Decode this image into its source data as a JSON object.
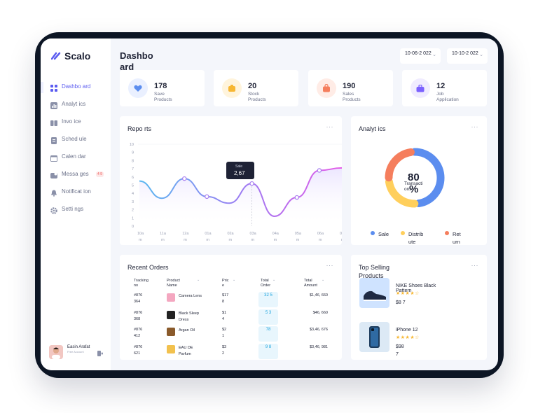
{
  "app": {
    "logo": "Scalo"
  },
  "sidebar": {
    "items": [
      {
        "label": "Dashbo ard",
        "icon": "grid-icon"
      },
      {
        "label": "Analyt ics",
        "icon": "chart-icon"
      },
      {
        "label": "Invo ice",
        "icon": "invoice-icon"
      },
      {
        "label": "Sched ule",
        "icon": "schedule-icon"
      },
      {
        "label": "Calen dar",
        "icon": "calendar-icon"
      },
      {
        "label": "Messa ges",
        "icon": "message-icon",
        "badge": "4 9"
      },
      {
        "label": "Notificat ion",
        "icon": "bell-icon"
      },
      {
        "label": "Setti ngs",
        "icon": "gear-icon"
      }
    ],
    "user": {
      "name": "Easin Arafat",
      "role": "Free Account"
    }
  },
  "header": {
    "title": "Dashbo ard",
    "date_from": "10-06-2 022",
    "date_to": "10-10-2 022"
  },
  "stats": [
    {
      "value": "178",
      "label": "Save Products",
      "icon": "heart-icon",
      "color": "#eaf0ff"
    },
    {
      "value": "20",
      "label": "Stock Products",
      "icon": "box-icon",
      "color": "#fff4dc"
    },
    {
      "value": "190",
      "label": "Sales Products",
      "icon": "bag-icon",
      "color": "#ffece6"
    },
    {
      "value": "12",
      "label": "Job Application",
      "icon": "briefcase-icon",
      "color": "#f0ecff"
    }
  ],
  "reports": {
    "title": "Repo rts",
    "more": "···",
    "tooltip": {
      "label": "Sale",
      "value": "2,67"
    },
    "chart_data": {
      "type": "area",
      "title": "Repo rts",
      "x": [
        "10a m",
        "11a m",
        "12a m",
        "01a m",
        "02a m",
        "03a m",
        "04a m",
        "05a m",
        "06a m",
        "07a m"
      ],
      "y_ticks": [
        "10",
        "9",
        "8",
        "7",
        "6",
        "5",
        "4",
        "3",
        "2",
        "1",
        "0"
      ],
      "ylim": [
        0,
        10
      ],
      "values": [
        5.5,
        3.4,
        5.8,
        3.6,
        2.8,
        5.2,
        1.2,
        3.5,
        6.8,
        7.1
      ],
      "highlight_index": 5
    }
  },
  "analytics": {
    "title": "Analyt ics",
    "more": "···",
    "center_value": "80",
    "center_unit": "%",
    "center_label": "Transacti ons",
    "chart_data": {
      "type": "pie",
      "labels": [
        "Sale",
        "Distrib ute",
        "Ret urn"
      ],
      "values": [
        50,
        25,
        25
      ],
      "colors": [
        "#5b8def",
        "#ffcf5c",
        "#f57e5d"
      ]
    }
  },
  "orders": {
    "title": "Recent Orders",
    "more": "···",
    "headers": [
      "Tracking no",
      "Product Name",
      "Pric e",
      "Total Order",
      "Total Amount"
    ],
    "rows": [
      {
        "tracking": "#876 364",
        "product": "Camera Lens",
        "price": "$17 8",
        "qty": "32 5",
        "amount": "$1,46, 660",
        "color": "#f4a7c0"
      },
      {
        "tracking": "#876 368",
        "product": "Black Sleep Dress",
        "price": "$1 4",
        "qty": "5 3",
        "amount": "$46, 660",
        "color": "#222222"
      },
      {
        "tracking": "#876 412",
        "product": "Argan Oil",
        "price": "$2 1",
        "qty": "78",
        "amount": "$3,46, 676",
        "color": "#8a5a2b"
      },
      {
        "tracking": "#876 621",
        "product": "EAU DE Parfum",
        "price": "$3 2",
        "qty": "9 8",
        "amount": "$3,46, 981",
        "color": "#f2c14e"
      }
    ]
  },
  "top_selling": {
    "title": "Top Selling Products",
    "more": "···",
    "items": [
      {
        "name": "NIKE Shoes Black Pattern",
        "price": "$8 7",
        "rating": "★★★★☆",
        "color": "#cfe3ff"
      },
      {
        "name": "iPhone 12",
        "price": "$98 7",
        "rating": "★★★★☆",
        "color": "#dce9f5"
      }
    ]
  }
}
